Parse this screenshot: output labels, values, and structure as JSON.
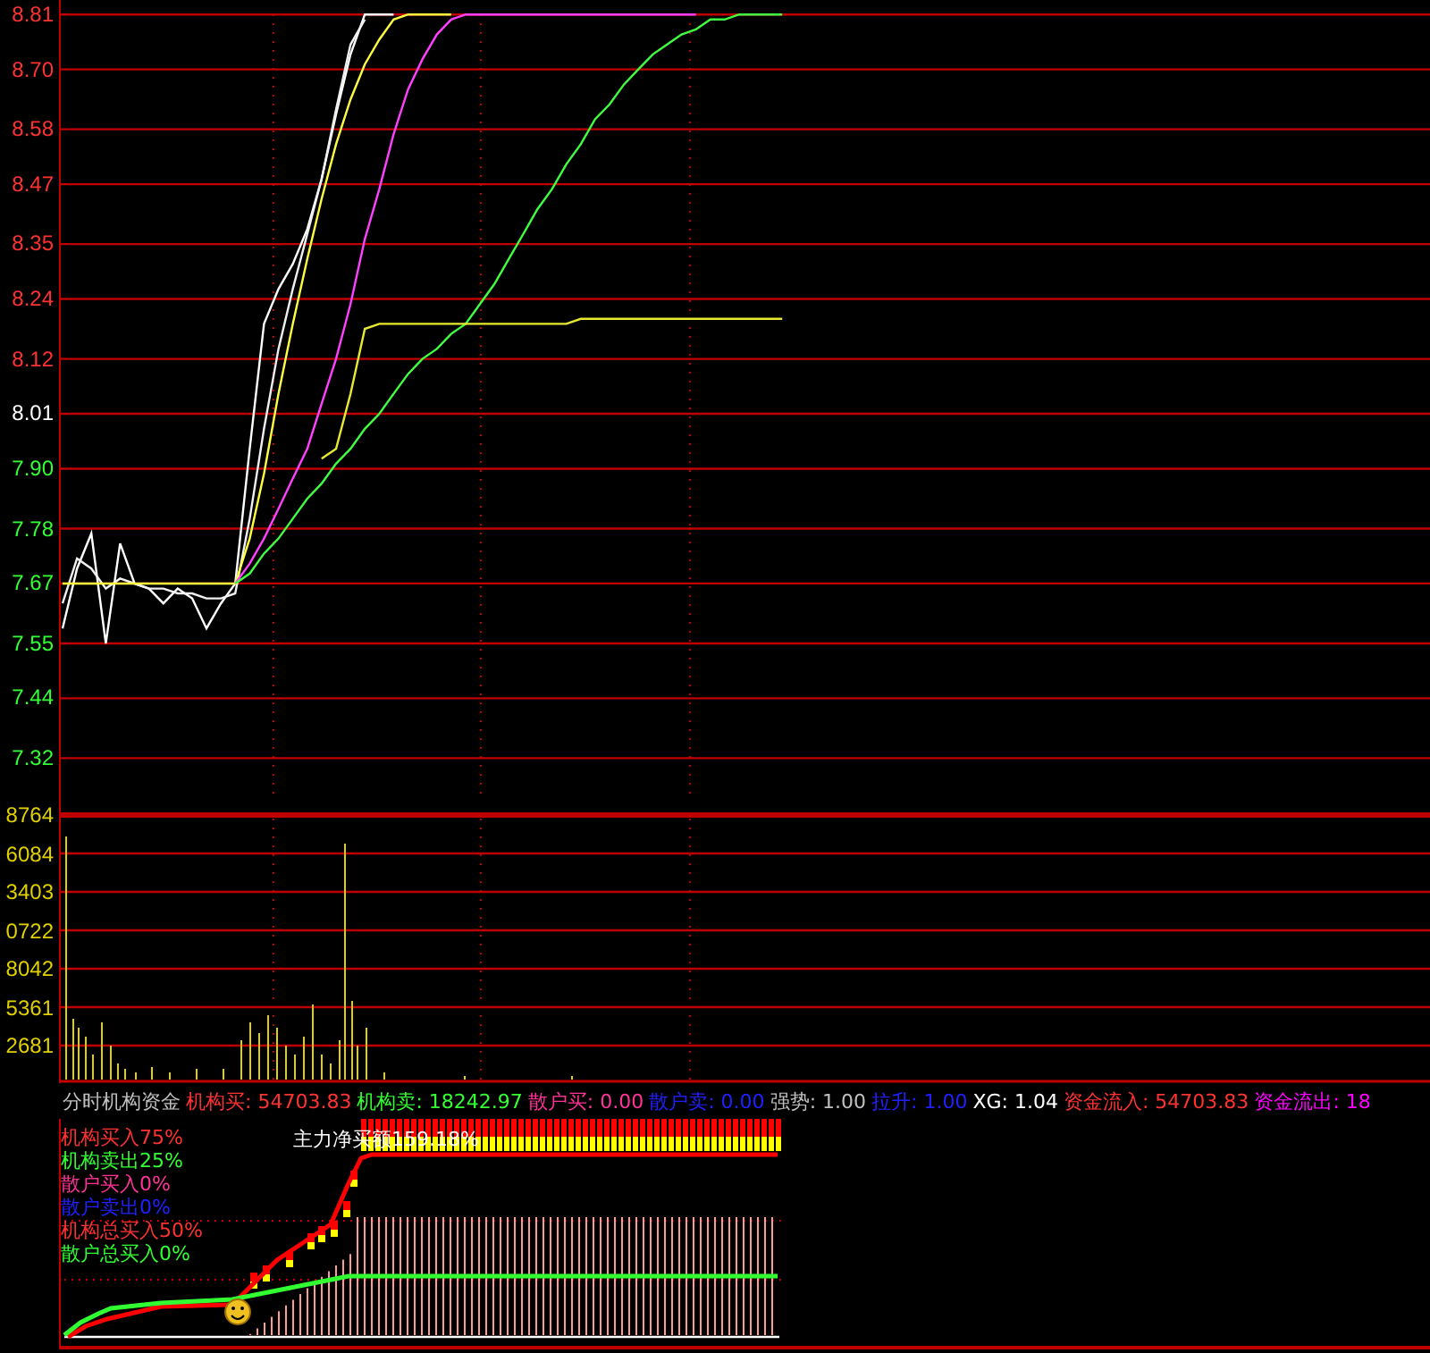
{
  "price_chart": {
    "tick_marks": [
      {
        "color": "#ff3232"
      },
      {
        "color": "#ff3232"
      },
      {
        "color": "#ff3232"
      },
      {
        "color": "#ff3232"
      },
      {
        "color": "#ff3232"
      },
      {
        "color": "#ff3232"
      },
      {
        "color": "#ff3232"
      },
      {
        "color": "#ffffff"
      },
      {
        "color": "#32ff32"
      },
      {
        "color": "#32ff32"
      },
      {
        "color": "#32ff32"
      },
      {
        "color": "#32ff32"
      },
      {
        "color": "#32ff32"
      },
      {
        "color": "#32ff32"
      }
    ],
    "chart_data": {
      "type": "line",
      "categories": [
        null,
        null,
        null,
        null,
        null,
        null,
        null,
        null,
        null,
        null,
        null,
        null,
        null,
        null,
        null,
        null,
        null,
        null,
        null,
        null,
        null,
        null,
        null,
        null,
        null,
        null,
        null,
        null,
        null,
        null,
        null,
        null,
        null,
        null,
        null,
        null,
        null,
        null,
        null,
        null,
        null,
        null,
        null,
        null,
        null,
        null,
        null,
        null,
        null,
        null,
        null,
        null,
        null,
        null,
        null,
        null,
        null,
        null,
        null,
        null,
        null,
        null,
        null,
        null,
        null,
        null,
        null,
        null,
        null,
        null,
        null,
        null,
        null,
        null,
        null,
        null,
        null,
        null,
        null,
        null,
        null,
        null,
        null,
        null,
        null,
        null,
        null,
        null,
        null,
        null,
        null,
        null,
        null,
        null,
        null,
        null
      ],
      "ylim": [
        6.669,
        8.839
      ],
      "grid": true,
      "yticks": [
        {
          "value": 8.81,
          "label": "8.81"
        },
        {
          "value": 8.7,
          "label": "8.70"
        },
        {
          "value": 8.58,
          "label": "8.58"
        },
        {
          "value": 8.47,
          "label": "8.47"
        },
        {
          "value": 8.35,
          "label": "8.35"
        },
        {
          "value": 8.24,
          "label": "8.24"
        },
        {
          "value": 8.12,
          "label": "8.12"
        },
        {
          "value": 8.01,
          "label": "8.01"
        },
        {
          "value": 7.9,
          "label": "7.90"
        },
        {
          "value": 7.78,
          "label": "7.78"
        },
        {
          "value": 7.67,
          "label": "7.67"
        },
        {
          "value": 7.55,
          "label": "7.55"
        },
        {
          "value": 7.44,
          "label": "7.44"
        },
        {
          "value": 7.32,
          "label": "7.32"
        }
      ],
      "series": [
        {
          "color": "#ffffff",
          "values": [
            7.58,
            7.7,
            7.77,
            7.55,
            7.75,
            7.67,
            7.66,
            7.63,
            7.66,
            7.64,
            7.58,
            7.63,
            7.67,
            7.94,
            8.19,
            8.26,
            8.31,
            8.38,
            8.48,
            8.61,
            8.73,
            8.81,
            8.81,
            8.81,
            null,
            null,
            null,
            null,
            null,
            null,
            null,
            null,
            null,
            null,
            null,
            null,
            null,
            null,
            null,
            null,
            null,
            null,
            null,
            null,
            null,
            null,
            null,
            null,
            null,
            null,
            null,
            null,
            null,
            null,
            null,
            null,
            null,
            null,
            null,
            null,
            null,
            null,
            null,
            null,
            null,
            null,
            null,
            null,
            null,
            null,
            null,
            null,
            null,
            null,
            null,
            null,
            null,
            null,
            null,
            null,
            null,
            null,
            null,
            null,
            null,
            null,
            null,
            null,
            null,
            null,
            null,
            null,
            null,
            null,
            null,
            null
          ]
        },
        {
          "color": "#f0f0f0",
          "values": [
            7.63,
            7.72,
            7.7,
            7.66,
            7.68,
            7.67,
            7.66,
            7.66,
            7.65,
            7.65,
            7.64,
            7.64,
            7.65,
            7.8,
            7.98,
            8.14,
            8.26,
            8.37,
            8.48,
            8.62,
            8.75,
            8.8,
            null,
            null,
            null,
            null,
            null,
            null,
            null,
            null,
            null,
            null,
            null,
            null,
            null,
            null,
            null,
            null,
            null,
            null,
            null,
            null,
            null,
            null,
            null,
            null,
            null,
            null,
            null,
            null,
            null,
            null,
            null,
            null,
            null,
            null,
            null,
            null,
            null,
            null,
            null,
            null,
            null,
            null,
            null,
            null,
            null,
            null,
            null,
            null,
            null,
            null,
            null,
            null,
            null,
            null,
            null,
            null,
            null,
            null,
            null,
            null,
            null,
            null,
            null,
            null,
            null,
            null,
            null,
            null,
            null,
            null,
            null,
            null,
            null,
            null
          ]
        },
        {
          "color": "#ffff40",
          "values": [
            7.67,
            7.67,
            7.67,
            7.67,
            7.67,
            7.67,
            7.67,
            7.67,
            7.67,
            7.67,
            7.67,
            7.67,
            7.67,
            7.76,
            7.89,
            8.05,
            8.19,
            8.32,
            8.44,
            8.55,
            8.64,
            8.71,
            8.76,
            8.8,
            8.81,
            8.81,
            8.81,
            8.81,
            null,
            null,
            null,
            null,
            null,
            null,
            null,
            null,
            null,
            null,
            null,
            null,
            null,
            null,
            null,
            null,
            null,
            null,
            null,
            null,
            null,
            null,
            null,
            null,
            null,
            null,
            null,
            null,
            null,
            null,
            null,
            null,
            null,
            null,
            null,
            null,
            null,
            null,
            null,
            null,
            null,
            null,
            null,
            null,
            null,
            null,
            null,
            null,
            null,
            null,
            null,
            null,
            null,
            null,
            null,
            null,
            null,
            null,
            null,
            null,
            null,
            null,
            null,
            null,
            null,
            null,
            null,
            null
          ]
        },
        {
          "color": "#ff40ff",
          "values": [
            null,
            null,
            null,
            null,
            null,
            null,
            null,
            null,
            null,
            null,
            null,
            null,
            7.67,
            7.71,
            7.76,
            7.82,
            7.88,
            7.94,
            8.03,
            8.12,
            8.23,
            8.36,
            8.46,
            8.57,
            8.66,
            8.72,
            8.77,
            8.8,
            8.81,
            8.81,
            8.81,
            8.81,
            8.81,
            8.81,
            8.81,
            8.81,
            8.81,
            8.81,
            8.81,
            8.81,
            8.81,
            8.81,
            8.81,
            8.81,
            8.81,
            null,
            null,
            null,
            null,
            null,
            null,
            null,
            null,
            null,
            null,
            null,
            null,
            null,
            null,
            null,
            null,
            null,
            null,
            null,
            null,
            null,
            null,
            null,
            null,
            null,
            null,
            null,
            null,
            null,
            null,
            null,
            null,
            null,
            null,
            null,
            null,
            null,
            null,
            null,
            null,
            null,
            null,
            null,
            null,
            null,
            null,
            null,
            null,
            null,
            null,
            null
          ]
        },
        {
          "color": "#40ff40",
          "values": [
            null,
            null,
            null,
            null,
            null,
            null,
            null,
            null,
            null,
            null,
            null,
            null,
            7.67,
            7.69,
            7.73,
            7.76,
            7.8,
            7.84,
            7.87,
            7.91,
            7.94,
            7.98,
            8.01,
            8.05,
            8.09,
            8.12,
            8.14,
            8.17,
            8.19,
            8.23,
            8.27,
            8.32,
            8.37,
            8.42,
            8.46,
            8.51,
            8.55,
            8.6,
            8.63,
            8.67,
            8.7,
            8.73,
            8.75,
            8.77,
            8.78,
            8.8,
            8.8,
            8.81,
            8.81,
            8.81,
            8.81,
            null,
            null,
            null,
            null,
            null,
            null,
            null,
            null,
            null,
            null,
            null,
            null,
            null,
            null,
            null,
            null,
            null,
            null,
            null,
            null,
            null,
            null,
            null,
            null,
            null,
            null,
            null,
            null,
            null,
            null,
            null,
            null,
            null,
            null,
            null,
            null,
            null,
            null,
            null,
            null,
            null,
            null,
            null,
            null,
            null
          ]
        },
        {
          "color": "#e8e830",
          "values": [
            null,
            null,
            null,
            null,
            null,
            null,
            null,
            null,
            null,
            null,
            null,
            null,
            null,
            null,
            null,
            null,
            null,
            null,
            7.92,
            7.94,
            8.05,
            8.18,
            8.19,
            8.19,
            8.19,
            8.19,
            8.19,
            8.19,
            8.19,
            8.19,
            8.19,
            8.19,
            8.19,
            8.19,
            8.19,
            8.19,
            8.2,
            8.2,
            8.2,
            8.2,
            8.2,
            8.2,
            8.2,
            8.2,
            8.2,
            8.2,
            8.2,
            8.2,
            8.2,
            8.2,
            8.2,
            null,
            null,
            null,
            null,
            null,
            null,
            null,
            null,
            null,
            null,
            null,
            null,
            null,
            null,
            null,
            null,
            null,
            null,
            null,
            null,
            null,
            null,
            null,
            null,
            null,
            null,
            null,
            null,
            null,
            null,
            null,
            null,
            null,
            null,
            null,
            null,
            null,
            null,
            null,
            null,
            null,
            null,
            null,
            null,
            null
          ]
        }
      ]
    }
  },
  "volume_axis": [
    "8764",
    "6084",
    "3403",
    "0722",
    "8042",
    "5361",
    "2681"
  ],
  "indicator": {
    "title": "分时机构资金",
    "readings": [
      {
        "text": "机构买: 54703.83",
        "color": "#ff3232"
      },
      {
        "text": "机构卖: 18242.97",
        "color": "#32ff32"
      },
      {
        "text": "散户买: 0.00",
        "color": "#ff3399"
      },
      {
        "text": "散户卖: 0.00",
        "color": "#2020ff"
      },
      {
        "text": "强势: 1.00",
        "color": "#c0c0c0"
      },
      {
        "text": "拉升: 1.00",
        "color": "#2020ff"
      },
      {
        "text": "XG: 1.04",
        "color": "#ffffff"
      },
      {
        "text": "资金流入: 54703.83",
        "color": "#ff3232"
      },
      {
        "text": "资金流出: 18",
        "color": "#ff00ff"
      }
    ]
  },
  "legend": [
    {
      "text": "机构买入75%",
      "color": "#ff3232"
    },
    {
      "text": "机构卖出25%",
      "color": "#32ff32"
    },
    {
      "text": "散户买入0%",
      "color": "#ff3399"
    },
    {
      "text": "散户卖出0%",
      "color": "#2020ff"
    },
    {
      "text": "机构总买入50%",
      "color": "#ff3232"
    },
    {
      "text": "散户总买入0%",
      "color": "#32ff32"
    }
  ],
  "overlay_label": "主力净买额159.18%"
}
